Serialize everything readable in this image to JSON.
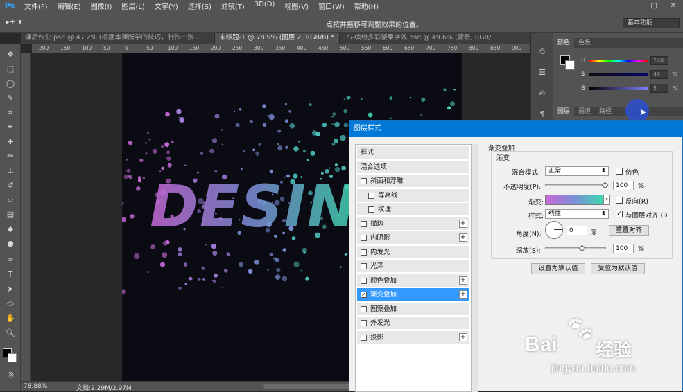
{
  "app": {
    "logo": "Ps"
  },
  "menu": [
    "文件(F)",
    "编辑(E)",
    "图像(I)",
    "图层(L)",
    "文字(Y)",
    "选择(S)",
    "滤镜(T)",
    "3D(D)",
    "视图(V)",
    "窗口(W)",
    "帮助(H)"
  ],
  "window_controls": [
    "—",
    "▢",
    "✕"
  ],
  "options_bar": {
    "tool_glyph": "▸+ ▾",
    "hint": "点按并拖移可调整效果的位置。",
    "workspace": "基本功能"
  },
  "tabs": [
    {
      "label": "课后作业.psd @ 47.2% (根据本课所学的技巧，制作一张...",
      "active": false
    },
    {
      "label": "未标题-1 @ 78.9% (图层 2, RGB/8) *",
      "active": true
    },
    {
      "label": "PS-缤纷多彩镂果字效.psd @ 49.6% (背景, RGB/...",
      "active": false
    }
  ],
  "ruler_ticks": [
    "200",
    "150",
    "100",
    "50",
    "0",
    "50",
    "100",
    "150",
    "200",
    "250",
    "300",
    "350",
    "400",
    "450",
    "500",
    "550",
    "600",
    "650",
    "700",
    "750",
    "800",
    "850",
    "900"
  ],
  "canvas": {
    "text": "DESIN"
  },
  "status": {
    "zoom": "78.88%",
    "doc": "文档:2.29M/2.97M"
  },
  "color_panel": {
    "tabs": [
      "颜色",
      "色板"
    ],
    "sliders": [
      {
        "label": "H",
        "value": "240",
        "unit": ""
      },
      {
        "label": "S",
        "value": "40",
        "unit": "%"
      },
      {
        "label": "B",
        "value": "5",
        "unit": "%"
      }
    ]
  },
  "layers_panel": {
    "tabs": [
      "图层",
      "通道",
      "路径"
    ]
  },
  "dialog": {
    "title": "图层样式",
    "styles": [
      {
        "label": "样式",
        "checkbox": false,
        "plus": false,
        "indent": 0,
        "selected": false,
        "checked": false
      },
      {
        "label": "混合选项",
        "checkbox": false,
        "plus": false,
        "indent": 0,
        "selected": false,
        "checked": false
      },
      {
        "label": "斜面和浮雕",
        "checkbox": true,
        "plus": false,
        "indent": 0,
        "selected": false,
        "checked": false
      },
      {
        "label": "等高线",
        "checkbox": true,
        "plus": false,
        "indent": 1,
        "selected": false,
        "checked": false
      },
      {
        "label": "纹理",
        "checkbox": true,
        "plus": false,
        "indent": 1,
        "selected": false,
        "checked": false
      },
      {
        "label": "描边",
        "checkbox": true,
        "plus": true,
        "indent": 0,
        "selected": false,
        "checked": false
      },
      {
        "label": "内阴影",
        "checkbox": true,
        "plus": true,
        "indent": 0,
        "selected": false,
        "checked": false
      },
      {
        "label": "内发光",
        "checkbox": true,
        "plus": false,
        "indent": 0,
        "selected": false,
        "checked": false
      },
      {
        "label": "光泽",
        "checkbox": true,
        "plus": false,
        "indent": 0,
        "selected": false,
        "checked": false
      },
      {
        "label": "颜色叠加",
        "checkbox": true,
        "plus": true,
        "indent": 0,
        "selected": false,
        "checked": false
      },
      {
        "label": "渐变叠加",
        "checkbox": true,
        "plus": true,
        "indent": 0,
        "selected": true,
        "checked": true
      },
      {
        "label": "图案叠加",
        "checkbox": true,
        "plus": false,
        "indent": 0,
        "selected": false,
        "checked": false
      },
      {
        "label": "外发光",
        "checkbox": true,
        "plus": false,
        "indent": 0,
        "selected": false,
        "checked": false
      },
      {
        "label": "投影",
        "checkbox": true,
        "plus": true,
        "indent": 0,
        "selected": false,
        "checked": false
      }
    ],
    "section_title": "渐变叠加",
    "group_title": "渐变",
    "blend_mode_label": "混合模式:",
    "blend_mode_value": "正常",
    "dither_label": "仿色",
    "opacity_label": "不透明度(P):",
    "opacity_value": "100",
    "opacity_unit": "%",
    "gradient_label": "渐变:",
    "reverse_label": "反向(R)",
    "style_label": "样式:",
    "style_value": "线性",
    "align_label": "与图层对齐 (I)",
    "angle_label": "角度(N):",
    "angle_value": "0",
    "angle_unit": "度",
    "reset_align_button": "重置对齐",
    "scale_label": "缩放(S):",
    "scale_value": "100",
    "scale_unit": "%",
    "make_default_button": "设置为默认值",
    "reset_default_button": "复位为默认值",
    "gradient_colors": [
      "#c86ad8",
      "#7c8fd8",
      "#3fd6b0"
    ]
  },
  "watermark": {
    "brand": "Bai",
    "brand2": "经验",
    "url": "jingyan.baidu.com"
  }
}
